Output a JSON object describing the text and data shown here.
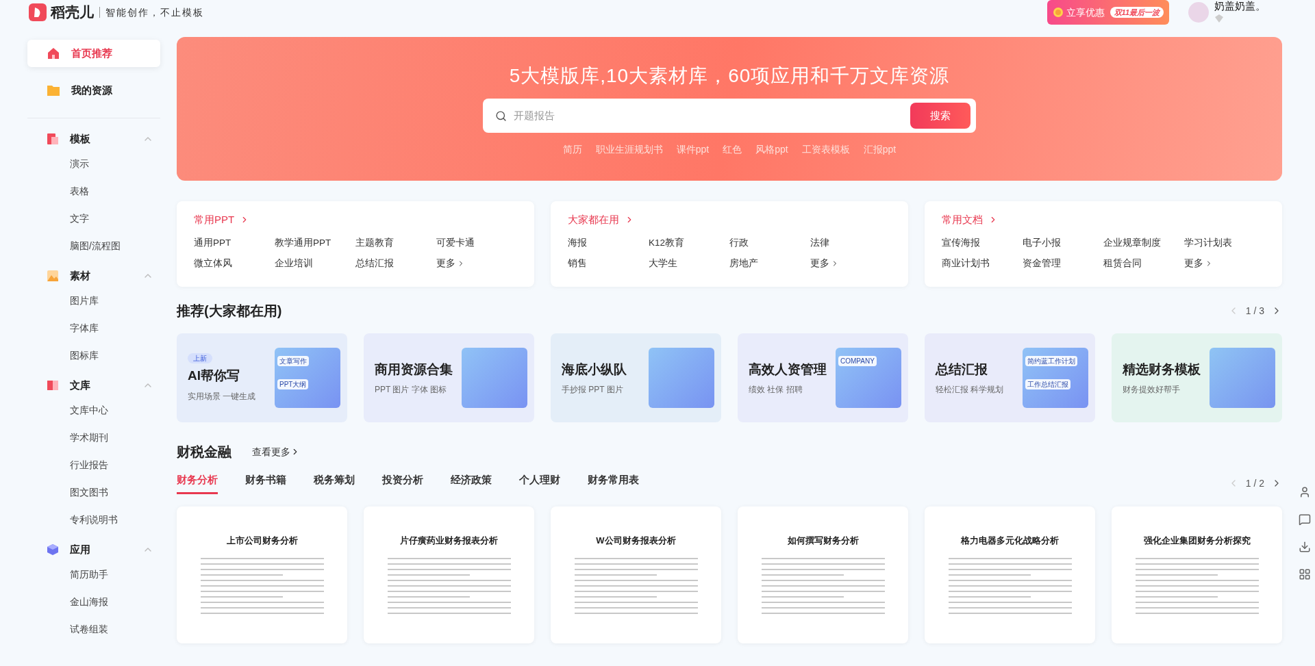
{
  "header": {
    "logo_text": "稻壳儿",
    "slogan": "智能创作，不止模板",
    "promo": {
      "label": "立享优惠",
      "badge": "双11最后一波"
    },
    "user": {
      "name": "奶盖奶盖。"
    }
  },
  "sidebar": {
    "top": [
      {
        "label": "首页推荐",
        "selected": true
      },
      {
        "label": "我的资源",
        "selected": false
      }
    ],
    "sections": [
      {
        "label": "模板",
        "expanded": true,
        "items": [
          "演示",
          "表格",
          "文字",
          "脑图/流程图"
        ]
      },
      {
        "label": "素材",
        "expanded": true,
        "items": [
          "图片库",
          "字体库",
          "图标库"
        ]
      },
      {
        "label": "文库",
        "expanded": true,
        "items": [
          "文库中心",
          "学术期刊",
          "行业报告",
          "图文图书",
          "专利说明书"
        ]
      },
      {
        "label": "应用",
        "expanded": true,
        "items": [
          "简历助手",
          "金山海报",
          "试卷组装"
        ]
      }
    ]
  },
  "banner": {
    "title": "5大模版库,10大素材库，60项应用和千万文库资源",
    "search": {
      "placeholder": "开题报告",
      "button": "搜索"
    },
    "hot_words": [
      "简历",
      "职业生涯规划书",
      "课件ppt",
      "红色",
      "风格ppt",
      "工资表模板",
      "汇报ppt"
    ]
  },
  "quick_cards": [
    {
      "title": "常用PPT",
      "links": [
        "通用PPT",
        "教学通用PPT",
        "主题教育",
        "可爱卡通",
        "微立体风",
        "企业培训",
        "总结汇报",
        "更多"
      ]
    },
    {
      "title": "大家都在用",
      "links": [
        "海报",
        "K12教育",
        "行政",
        "法律",
        "销售",
        "大学生",
        "房地产",
        "更多"
      ]
    },
    {
      "title": "常用文档",
      "links": [
        "宣传海报",
        "电子小报",
        "企业规章制度",
        "学习计划表",
        "商业计划书",
        "资金管理",
        "租赁合同",
        "更多"
      ]
    }
  ],
  "recommend": {
    "title": "推荐(大家都在用)",
    "pager": "1 / 3",
    "cards": [
      {
        "title": "AI帮你写",
        "subtitle": "实用场景 一键生成",
        "badge": "上新",
        "art_texts": [
          "文章写作",
          "PPT大纲"
        ]
      },
      {
        "title": "商用资源合集",
        "subtitle": "PPT 图片 字体 图标"
      },
      {
        "title": "海底小纵队",
        "subtitle": "手抄报 PPT 图片"
      },
      {
        "title": "高效人资管理",
        "subtitle": "绩效 社保 招聘",
        "art_texts": [
          "COMPANY"
        ]
      },
      {
        "title": "总结汇报",
        "subtitle": "轻松汇报 科学规划",
        "art_texts": [
          "简约蓝工作计划",
          "工作总结汇报"
        ]
      },
      {
        "title": "精选财务模板",
        "subtitle": "财务提效好帮手"
      }
    ]
  },
  "finance": {
    "title": "财税金融",
    "more": "查看更多",
    "pager": "1 / 2",
    "tabs": [
      {
        "label": "财务分析",
        "selected": true
      },
      {
        "label": "财务书籍",
        "selected": false
      },
      {
        "label": "税务筹划",
        "selected": false
      },
      {
        "label": "投资分析",
        "selected": false
      },
      {
        "label": "经济政策",
        "selected": false
      },
      {
        "label": "个人理财",
        "selected": false
      },
      {
        "label": "财务常用表",
        "selected": false
      }
    ],
    "docs": [
      {
        "title": "上市公司财务分析"
      },
      {
        "title": "片仔癀药业财务报表分析"
      },
      {
        "title": "W公司财务报表分析"
      },
      {
        "title": "如何撰写财务分析"
      },
      {
        "title": "格力电器多元化战略分析"
      },
      {
        "title": "强化企业集团财务分析探究"
      }
    ]
  }
}
